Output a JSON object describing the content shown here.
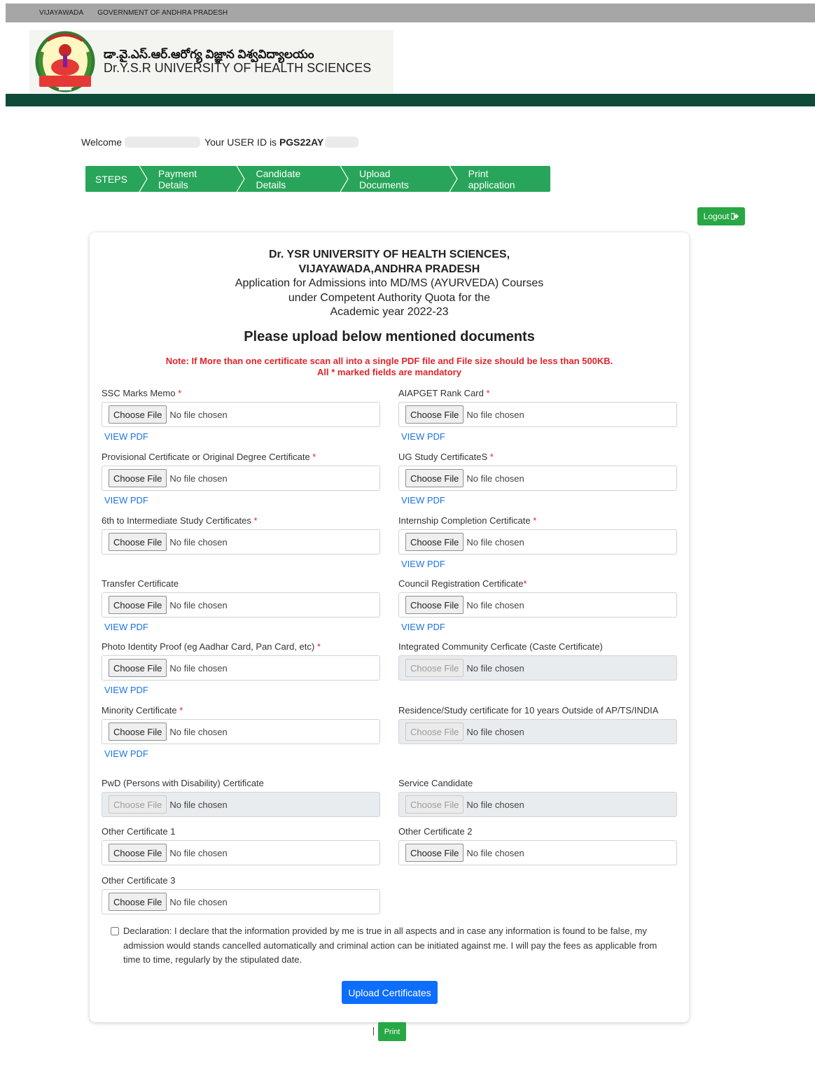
{
  "topbar": {
    "city": "VIJAYAWADA",
    "government": "GOVERNMENT OF ANDHRA PRADESH"
  },
  "brand": {
    "telugu": "డా.వై.ఎస్.ఆర్.ఆరోగ్య విజ్ఞాన విశ్వవిద్యాలయం",
    "english": "Dr.Y.S.R UNIVERSITY OF HEALTH SCIENCES"
  },
  "welcome": {
    "prefix": "Welcome",
    "userid_prefix": "Your USER ID is",
    "userid": "PGS22AY"
  },
  "steps": [
    "STEPS",
    "Payment Details",
    "Candidate Details",
    "Upload Documents",
    "Print application"
  ],
  "logout": "Logout",
  "heading": {
    "line1": "Dr. YSR UNIVERSITY OF HEALTH SCIENCES,",
    "line2": "VIJAYAWADA,ANDHRA PRADESH",
    "line3": "Application for Admissions into MD/MS (AYURVEDA) Courses",
    "line4": "under Competent Authority Quota for the",
    "line5": "Academic year 2022-23"
  },
  "subheading": "Please upload below mentioned documents",
  "note": {
    "line1": "Note: If More than one certificate scan all into a single PDF file and File size should be less than 500KB.",
    "line2": "All * marked fields are mandatory"
  },
  "file_input": {
    "choose": "Choose File",
    "none": "No file chosen",
    "view_pdf": "VIEW PDF"
  },
  "fields": [
    {
      "label": "SSC Marks Memo",
      "required": true,
      "view_pdf": true,
      "disabled": false
    },
    {
      "label": "AIAPGET Rank Card",
      "required": true,
      "view_pdf": true,
      "disabled": false
    },
    {
      "label": "Provisional Certificate or Original Degree Certificate",
      "required": true,
      "view_pdf": true,
      "disabled": false
    },
    {
      "label": "UG Study CertificateS",
      "required": true,
      "view_pdf": true,
      "disabled": false
    },
    {
      "label": "6th to Intermediate Study Certificates",
      "required": true,
      "view_pdf": false,
      "disabled": false
    },
    {
      "label": "Internship Completion Certificate",
      "required": true,
      "view_pdf": true,
      "disabled": false
    },
    {
      "label": "Transfer Certificate",
      "required": false,
      "view_pdf": true,
      "disabled": false
    },
    {
      "label": "Council Registration Certificate",
      "required": true,
      "view_pdf": true,
      "disabled": false
    },
    {
      "label": "Photo Identity Proof (eg Aadhar Card, Pan Card, etc)",
      "required": true,
      "view_pdf": true,
      "disabled": false
    },
    {
      "label": "Integrated Community Cerficate (Caste Certificate)",
      "required": false,
      "view_pdf": false,
      "disabled": true
    },
    {
      "label": "Minority Certificate",
      "required": true,
      "view_pdf": true,
      "disabled": false
    },
    {
      "label": "Residence/Study certificate for 10 years Outside of AP/TS/INDIA",
      "required": false,
      "view_pdf": false,
      "disabled": true
    },
    {
      "label": "PwD (Persons with Disability) Certificate",
      "required": false,
      "view_pdf": false,
      "disabled": true
    },
    {
      "label": "Service Candidate",
      "required": false,
      "view_pdf": false,
      "disabled": true
    },
    {
      "label": "Other Certificate 1",
      "required": false,
      "view_pdf": false,
      "disabled": false
    },
    {
      "label": "Other Certificate 2",
      "required": false,
      "view_pdf": false,
      "disabled": false
    },
    {
      "label": "Other Certificate 3",
      "required": false,
      "view_pdf": false,
      "disabled": false
    }
  ],
  "declaration": "Declaration: I declare that the information provided by me is true in all aspects and in case any information is found to be false, my admission would stands cancelled automatically and criminal action can be initiated against me. I will pay the fees as applicable from time to time, regularly by the stipulated date.",
  "upload_button": "Upload Certificates",
  "print_button": "Print",
  "colors": {
    "green": "#28a55a",
    "dark_green": "#0e4b3a",
    "blue": "#0d6efd",
    "red": "#e0242b"
  }
}
